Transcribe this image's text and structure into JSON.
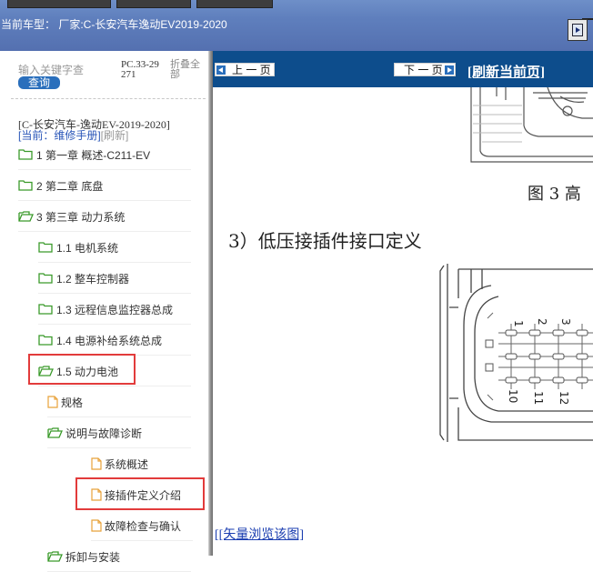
{
  "window": {
    "car_label": "当前车型：  厂家:C-长安汽车逸动EV2019-2020"
  },
  "sidebar": {
    "search_placeholder": "输入关键字查",
    "search_button": "查询",
    "pc_code": "PC.33-29271",
    "collapse_all": "折叠全部",
    "model_name": "[C-长安汽车-逸动EV-2019-2020]",
    "current_label": "[当前：维修手册]",
    "refresh_label": "[刷新]",
    "tree": [
      {
        "label": "1 第一章 概述-C211-EV",
        "type": "folder",
        "open": false
      },
      {
        "label": "2 第二章 底盘",
        "type": "folder",
        "open": false
      },
      {
        "label": "3 第三章 动力系统",
        "type": "folder",
        "open": true
      },
      {
        "label": "1.1 电机系统",
        "type": "folder",
        "open": false
      },
      {
        "label": "1.2 整车控制器",
        "type": "folder",
        "open": false
      },
      {
        "label": "1.3 远程信息监控器总成",
        "type": "folder",
        "open": false
      },
      {
        "label": "1.4 电源补给系统总成",
        "type": "folder",
        "open": false
      },
      {
        "label": "1.5 动力电池",
        "type": "folder",
        "open": true
      },
      {
        "label": "规格",
        "type": "file"
      },
      {
        "label": "说明与故障诊断",
        "type": "folder",
        "open": true
      },
      {
        "label": "系统概述",
        "type": "file"
      },
      {
        "label": "接插件定义介绍",
        "type": "file"
      },
      {
        "label": "故障检查与确认",
        "type": "file"
      },
      {
        "label": "拆卸与安装",
        "type": "folder",
        "open": true
      }
    ]
  },
  "content": {
    "prev_button": "上 一 页",
    "next_button": "下 一 页",
    "refresh_page": "[刷新当前页]",
    "figure_caption": "图 3  高",
    "section_heading": "3）低压接插件接口定义",
    "connector_pins_top": [
      "1",
      "2",
      "3"
    ],
    "connector_pins_bottom": [
      "10",
      "11",
      "12"
    ],
    "vector_link_open": "[",
    "vector_link": "[矢量浏览该图]"
  },
  "colors": {
    "toolbar": "#0d4d8c",
    "highlight": "#e23b3b",
    "link": "#1a3db0",
    "folder": "#3a9a2a",
    "file": "#e8a23a"
  }
}
